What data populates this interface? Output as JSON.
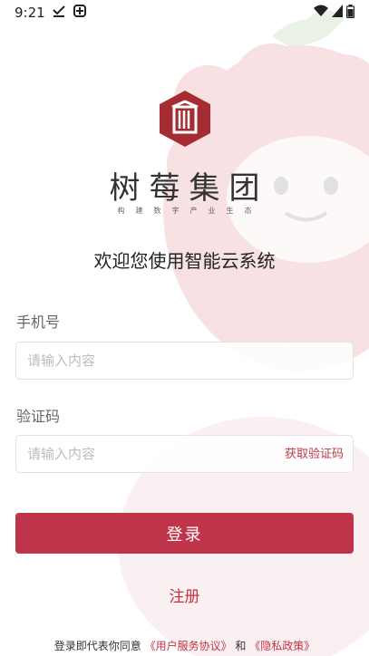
{
  "status_bar": {
    "time": "9:21",
    "icons": [
      "download-check-icon",
      "app-notification-icon",
      "wifi-icon",
      "cell-signal-icon",
      "battery-icon"
    ]
  },
  "brand": {
    "name": "树莓集团",
    "slogan": "构建数字产业生态",
    "colors": {
      "primary": "#bf3448",
      "badge": "#a52c33"
    }
  },
  "welcome": "欢迎您使用智能云系统",
  "form": {
    "phone_label": "手机号",
    "phone_placeholder": "请输入内容",
    "code_label": "验证码",
    "code_placeholder": "请输入内容",
    "get_code": "获取验证码"
  },
  "actions": {
    "login": "登录",
    "register": "注册"
  },
  "agreement": {
    "prefix": "登录即代表你同意",
    "terms": "《用户服务协议》",
    "and": "和",
    "privacy": "《隐私政策》"
  }
}
